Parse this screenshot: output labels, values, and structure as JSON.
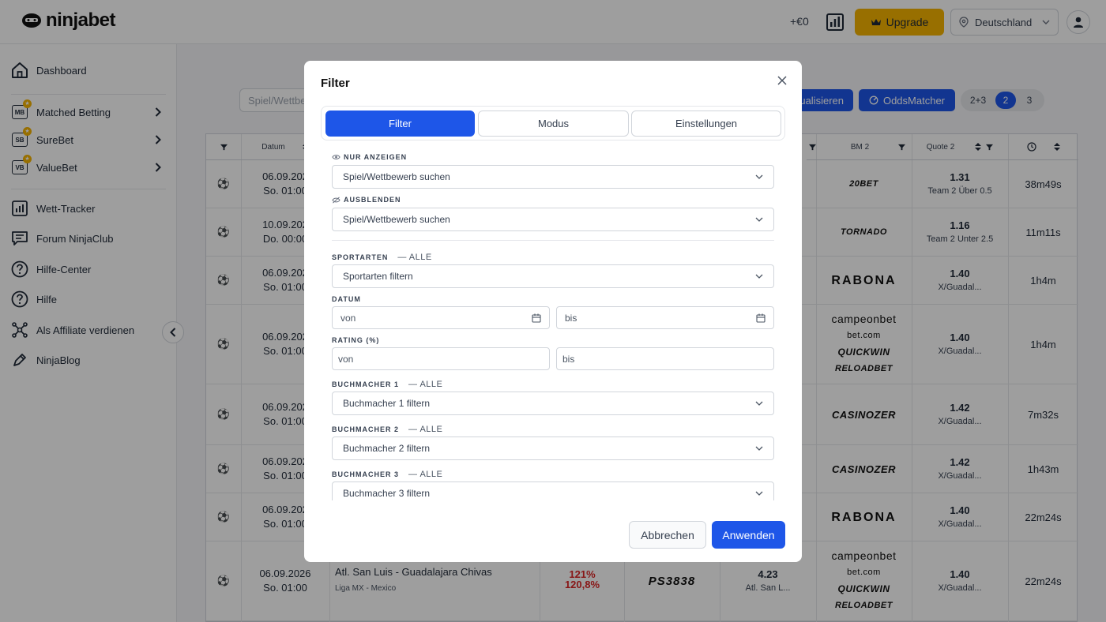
{
  "brand": {
    "name": "ninjabet"
  },
  "header": {
    "balance": "+€0",
    "upgrade_label": "Upgrade",
    "country": "Deutschland"
  },
  "sidebar": {
    "items": [
      {
        "label": "Dashboard"
      },
      {
        "label": "Matched Betting",
        "badge": "MB"
      },
      {
        "label": "SureBet",
        "badge": "SB"
      },
      {
        "label": "ValueBet",
        "badge": "VB"
      },
      {
        "label": "Wett-Tracker"
      },
      {
        "label": "Forum NinjaClub"
      },
      {
        "label": "Hilfe-Center"
      },
      {
        "label": "Hilfe"
      },
      {
        "label": "Als Affiliate verdienen"
      },
      {
        "label": "NinjaBlog"
      }
    ]
  },
  "toolbar": {
    "search_placeholder": "Spiel/Wettbe",
    "aktualisieren_label": "ualisieren",
    "oddsmatcher_label": "OddsMatcher",
    "segments": [
      "2+3",
      "2",
      "3"
    ],
    "active_segment": "2"
  },
  "table": {
    "headers": {
      "datum": "Datum",
      "bm2": "BM 2",
      "quote2": "Quote 2"
    },
    "rows": [
      {
        "date": "06.09.202",
        "time": "So. 01:00",
        "bm2": "20BET",
        "quote": "1.31",
        "label": "Team 2 Über 0.5",
        "remaining": "38m49s"
      },
      {
        "date": "10.09.202",
        "time": "Do. 00:00",
        "bm2": "TORNADO",
        "quote": "1.16",
        "label": "Team 2 Unter 2.5",
        "remaining": "11m11s"
      },
      {
        "date": "06.09.202",
        "time": "So. 01:00",
        "bm2": "RABONA",
        "quote": "1.40",
        "label": "X/Guadal...",
        "remaining": "1h4m"
      },
      {
        "date": "06.09.202",
        "time": "So. 01:00",
        "bm2_multi": [
          "campeonbet",
          "bet.com",
          "QUICKWIN",
          "RELOADBET"
        ],
        "quote": "1.40",
        "label": "X/Guadal...",
        "remaining": "1h4m"
      },
      {
        "date": "06.09.202",
        "time": "So. 01:00",
        "bm2": "CASINOZER",
        "quote": "1.42",
        "label": "X/Guadal...",
        "remaining": "7m32s"
      },
      {
        "date": "06.09.202",
        "time": "So. 01:00",
        "bm2": "CASINOZER",
        "quote": "1.42",
        "label": "X/Guadal...",
        "remaining": "1h43m"
      },
      {
        "date": "06.09.202",
        "time": "So. 01:00",
        "bm2": "RABONA",
        "quote": "1.40",
        "label": "X/Guadal...",
        "remaining": "22m24s"
      },
      {
        "date": "06.09.2026",
        "time": "So. 01:00",
        "match": "Atl. San Luis - Guadalajara Chivas",
        "league": "Liga MX - Mexico",
        "rating1": "121%",
        "rating2": "120,8%",
        "bm1": "PS3838",
        "quote1": "4.23",
        "quote1_label": "Atl. San L...",
        "bm2_multi": [
          "campeonbet",
          "bet.com",
          "QUICKWIN",
          "RELOADBET"
        ],
        "quote": "1.40",
        "label": "X/Guadal...",
        "remaining": "22m24s"
      }
    ]
  },
  "modal": {
    "title": "Filter",
    "tabs": [
      "Filter",
      "Modus",
      "Einstellungen"
    ],
    "nur_anzeigen": {
      "label": "NUR ANZEIGEN",
      "placeholder": "Spiel/Wettbewerb suchen"
    },
    "ausblenden": {
      "label": "AUSBLENDEN",
      "placeholder": "Spiel/Wettbewerb suchen"
    },
    "sportarten": {
      "label": "SPORTARTEN",
      "alle": "— ALLE",
      "placeholder": "Sportarten filtern"
    },
    "datum": {
      "label": "DATUM",
      "from": "von",
      "to": "bis"
    },
    "rating": {
      "label": "RATING (%)",
      "from": "von",
      "to": "bis"
    },
    "bm1": {
      "label": "BUCHMACHER 1",
      "alle": "— ALLE",
      "placeholder": "Buchmacher 1 filtern"
    },
    "bm2": {
      "label": "BUCHMACHER 2",
      "alle": "— ALLE",
      "placeholder": "Buchmacher 2 filtern"
    },
    "bm3": {
      "label": "BUCHMACHER 3",
      "alle": "— ALLE",
      "placeholder": "Buchmacher 3 filtern"
    },
    "cancel_label": "Abbrechen",
    "apply_label": "Anwenden"
  }
}
